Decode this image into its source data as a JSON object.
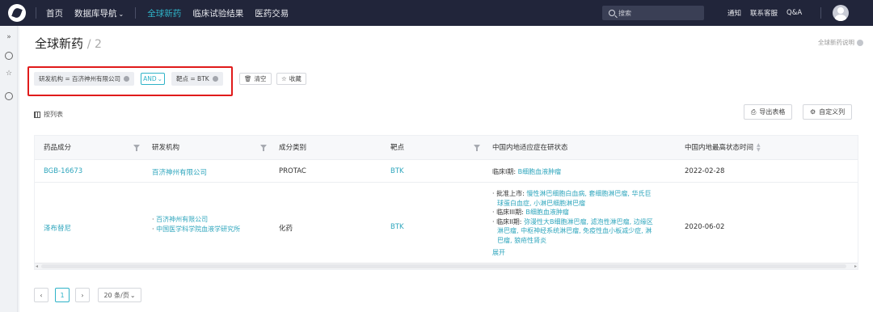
{
  "topbar": {
    "nav": [
      "首页",
      "数据库导航",
      "全球新药",
      "临床试验结果",
      "医药交易"
    ],
    "search_placeholder": "搜索",
    "links": [
      "通知",
      "联系客服",
      "Q&A"
    ]
  },
  "page": {
    "title": "全球新药",
    "count": "/ 2",
    "help": "全球新药说明"
  },
  "filters": {
    "chip1": "研发机构 = 百济神州有限公司",
    "logic": "AND",
    "chip2": "靶点 = BTK",
    "clear": "清空",
    "save": "收藏"
  },
  "toolbar": {
    "view": "按列表",
    "export": "导出表格",
    "custom_cols": "自定义列"
  },
  "table": {
    "headers": [
      "药品成分",
      "研发机构",
      "成分类别",
      "靶点",
      "中国内地适应症在研状态",
      "中国内地最高状态时间"
    ],
    "row1": {
      "drug": "BGB-16673",
      "org": "百济神州有限公司",
      "type": "PROTAC",
      "target": "BTK",
      "status_label": "临床I期:",
      "status_value": "B细胞血液肿瘤",
      "date": "2022-02-28"
    },
    "row2": {
      "drug": "泽布替尼",
      "orgs": [
        "百济神州有限公司",
        "中国医学科学院血液学研究所"
      ],
      "type": "化药",
      "target": "BTK",
      "status_lines": [
        {
          "label": "批准上市:",
          "value": "慢性淋巴细胞白血病, 套细胞淋巴瘤, 华氏巨"
        },
        {
          "label": "",
          "value": "球蛋白血症, 小淋巴细胞淋巴瘤"
        },
        {
          "label": "临床III期:",
          "value": "B细胞血液肿瘤"
        },
        {
          "label": "临床II期:",
          "value": "弥漫性大B细胞淋巴瘤, 滤泡性淋巴瘤, 边缘区"
        },
        {
          "label": "",
          "value": "淋巴瘤, 中枢神经系统淋巴瘤, 免疫性血小板减少症, 淋"
        },
        {
          "label": "",
          "value": "巴瘤, 狼疮性肾炎"
        }
      ],
      "expand": "展开",
      "date": "2020-06-02"
    }
  },
  "pagination": {
    "current": "1",
    "page_size": "20 条/页"
  },
  "colors": {
    "accent": "#2fb3c8",
    "highlight_border": "#e01b1b",
    "topbar": "#21253a"
  }
}
